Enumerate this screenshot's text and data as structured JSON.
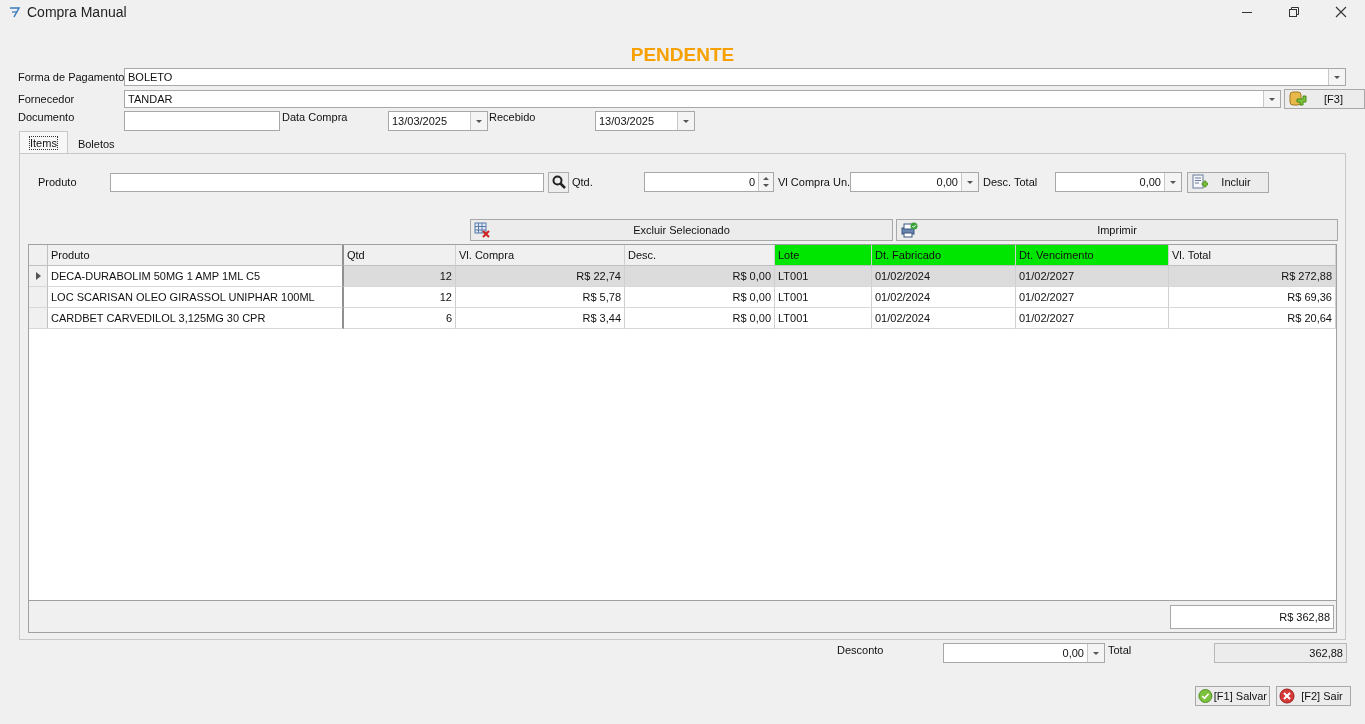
{
  "window": {
    "title": "Compra Manual"
  },
  "status": "PENDENTE",
  "form": {
    "payment": {
      "label": "Forma de Pagamento",
      "value": "BOLETO"
    },
    "supplier": {
      "label": "Fornecedor",
      "value": "TANDAR",
      "button": "[F3]"
    },
    "document": {
      "label": "Documento"
    },
    "purchase_date": {
      "label": "Data Compra",
      "value": "13/03/2025"
    },
    "received": {
      "label": "Recebido",
      "value": "13/03/2025"
    }
  },
  "tabs": [
    {
      "label": "Items",
      "selected": true
    },
    {
      "label": "Boletos",
      "selected": false
    }
  ],
  "entry": {
    "product_label": "Produto",
    "qty_label": "Qtd.",
    "qty": "0",
    "unit_price_label": "Vl Compra Un.",
    "unit_price": "0,00",
    "discount_label": "Desc. Total",
    "discount": "0,00",
    "add_button": "Incluir"
  },
  "actions": {
    "delete": "Excluir Selecionado",
    "print": "Imprimir"
  },
  "table": {
    "columns": [
      {
        "label": "Produto",
        "highlight": false,
        "kind": "text"
      },
      {
        "label": "Qtd",
        "highlight": false,
        "kind": "number"
      },
      {
        "label": "Vl. Compra",
        "highlight": false,
        "kind": "number"
      },
      {
        "label": "Desc.",
        "highlight": false,
        "kind": "number"
      },
      {
        "label": "Lote",
        "highlight": true,
        "kind": "text"
      },
      {
        "label": "Dt. Fabricado",
        "highlight": true,
        "kind": "text"
      },
      {
        "label": "Dt. Vencimento",
        "highlight": true,
        "kind": "text"
      },
      {
        "label": "Vl. Total",
        "highlight": false,
        "kind": "number"
      }
    ],
    "rows": [
      {
        "selected": true,
        "cells": [
          "DECA-DURABOLIM 50MG 1 AMP 1ML C5",
          "12",
          "R$ 22,74",
          "R$ 0,00",
          "LT001",
          "01/02/2024",
          "01/02/2027",
          "R$ 272,88"
        ]
      },
      {
        "selected": false,
        "cells": [
          "LOC SCARISAN OLEO GIRASSOL UNIPHAR 100ML",
          "12",
          "R$ 5,78",
          "R$ 0,00",
          "LT001",
          "01/02/2024",
          "01/02/2027",
          "R$ 69,36"
        ]
      },
      {
        "selected": false,
        "cells": [
          "CARDBET CARVEDILOL 3,125MG 30 CPR",
          "6",
          "R$ 3,44",
          "R$ 0,00",
          "LT001",
          "01/02/2024",
          "01/02/2027",
          "R$ 20,64"
        ]
      }
    ],
    "footer_total": "R$ 362,88"
  },
  "totals": {
    "discount_label": "Desconto",
    "discount": "0,00",
    "total_label": "Total",
    "total": "362,88"
  },
  "buttons": [
    {
      "label": "[F1] Salvar",
      "kind": "save"
    },
    {
      "label": "[F2] Sair",
      "kind": "exit"
    }
  ]
}
